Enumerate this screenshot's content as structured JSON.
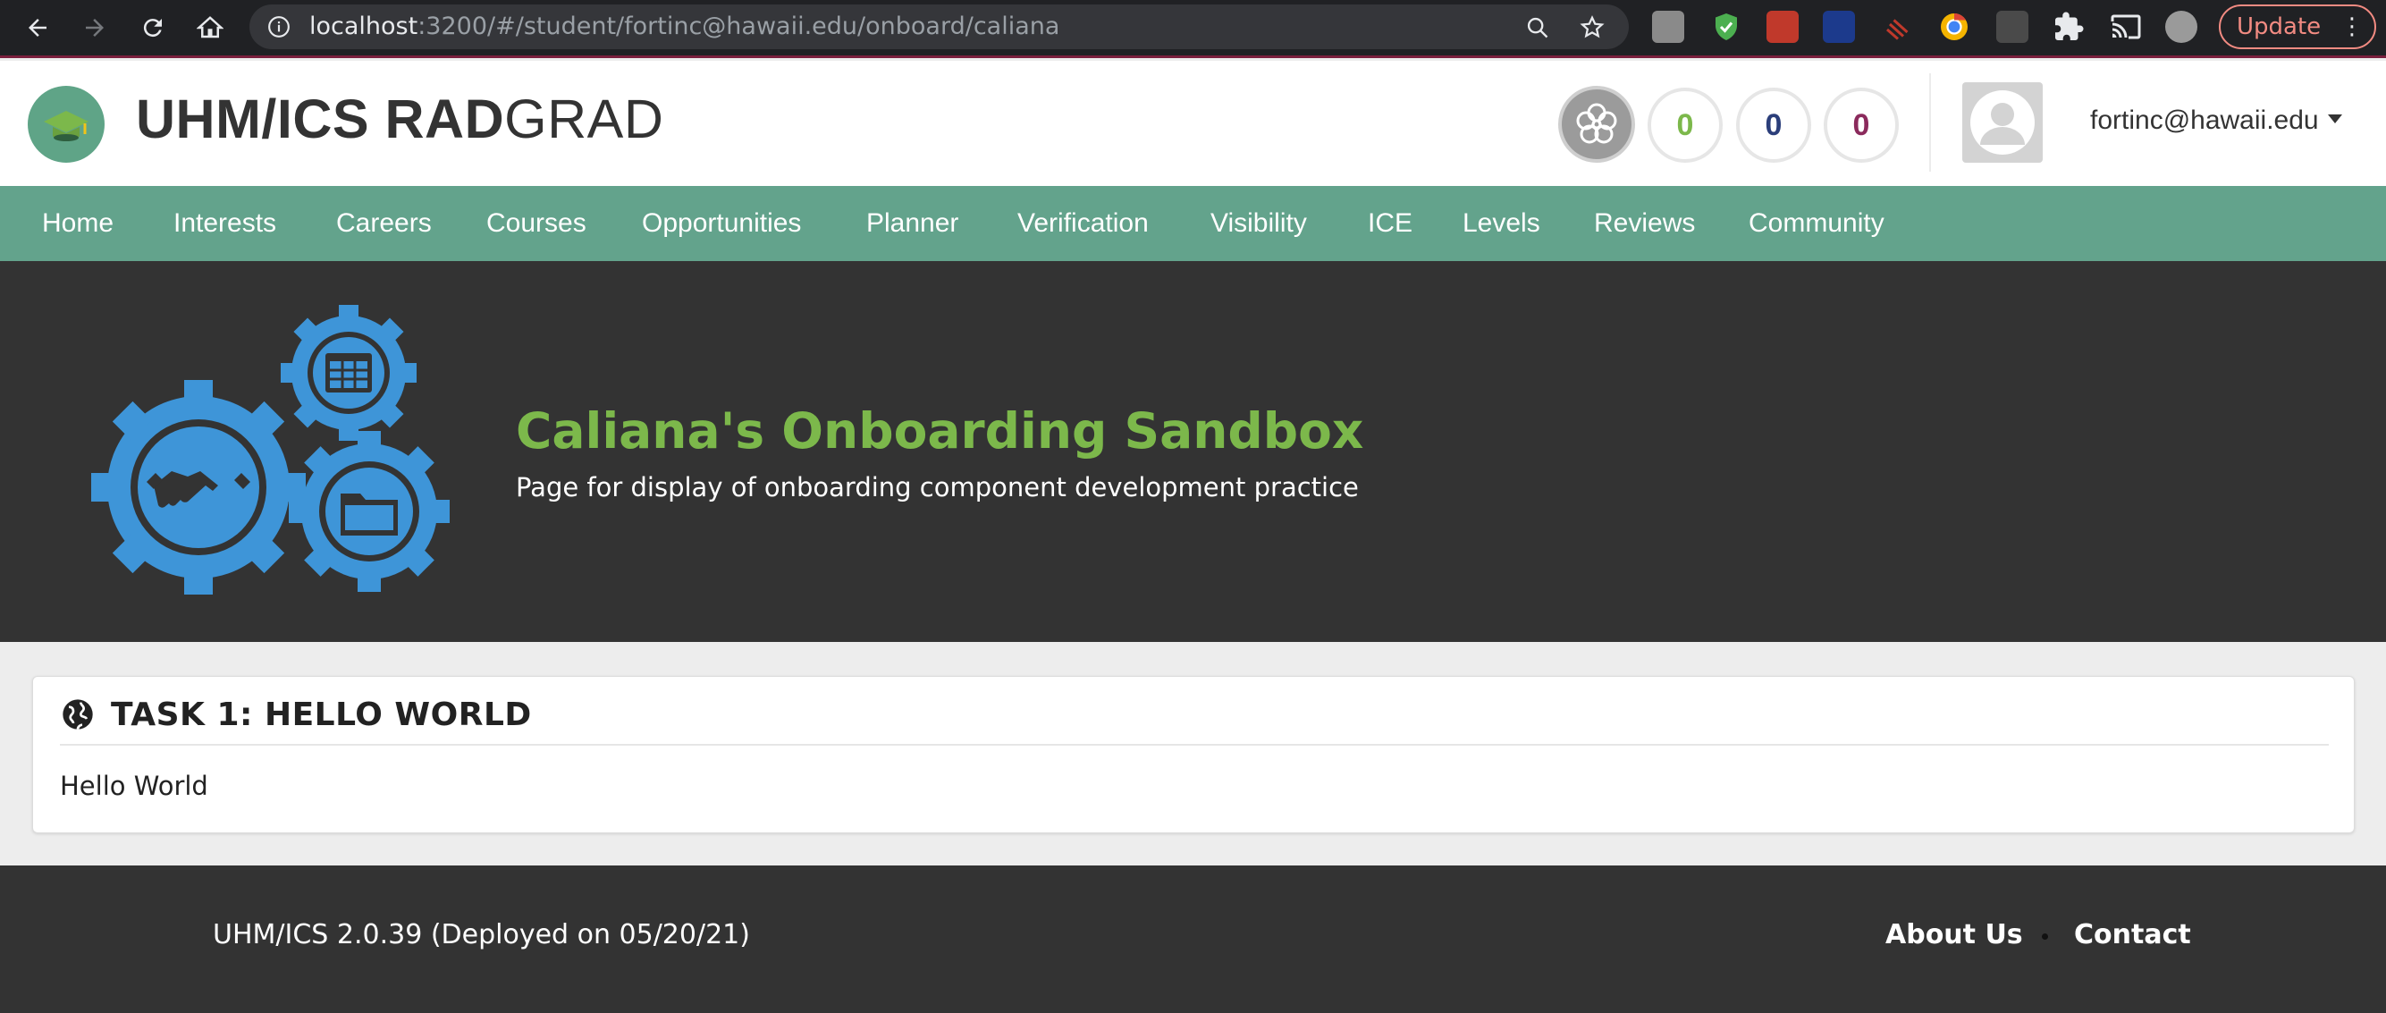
{
  "browser": {
    "url_host": "localhost",
    "url_rest": ":3200/#/student/fortinc@hawaii.edu/onboard/caliana",
    "update_label": "Update",
    "nav_icons": [
      "back-arrow-icon",
      "forward-arrow-icon",
      "reload-icon",
      "home-icon"
    ],
    "extension_icons": [
      "leoh-icon",
      "shield-check-icon",
      "bug-icon",
      "wing-icon",
      "scribble-icon",
      "chrome-canary-icon",
      "terminal-icon",
      "puzzle-piece-icon",
      "cast-icon",
      "profile-avatar-icon"
    ]
  },
  "header": {
    "brand_bold": "UHM/ICS RAD",
    "brand_light": "GRAD",
    "ice": {
      "innovation": "0",
      "competency": "0",
      "experience": "0",
      "colors": {
        "innovation": "#7cb84b",
        "competency": "#2b3e7a",
        "experience": "#8b2a5c"
      }
    },
    "user_email": "fortinc@hawaii.edu"
  },
  "menu": {
    "items": [
      "Home",
      "Interests",
      "Careers",
      "Courses",
      "Opportunities",
      "Planner",
      "Verification",
      "Visibility",
      "ICE",
      "Levels",
      "Reviews",
      "Community"
    ]
  },
  "hero": {
    "title": "Caliana's Onboarding Sandbox",
    "subtitle": "Page for display of onboarding component development practice",
    "accent_color": "#7cb84b",
    "gear_color": "#3e95d8"
  },
  "task": {
    "title": "TASK 1: HELLO WORLD",
    "body": "Hello World"
  },
  "footer": {
    "version": "UHM/ICS 2.0.39 (Deployed on 05/20/21)",
    "about_label": "About Us",
    "contact_label": "Contact"
  }
}
